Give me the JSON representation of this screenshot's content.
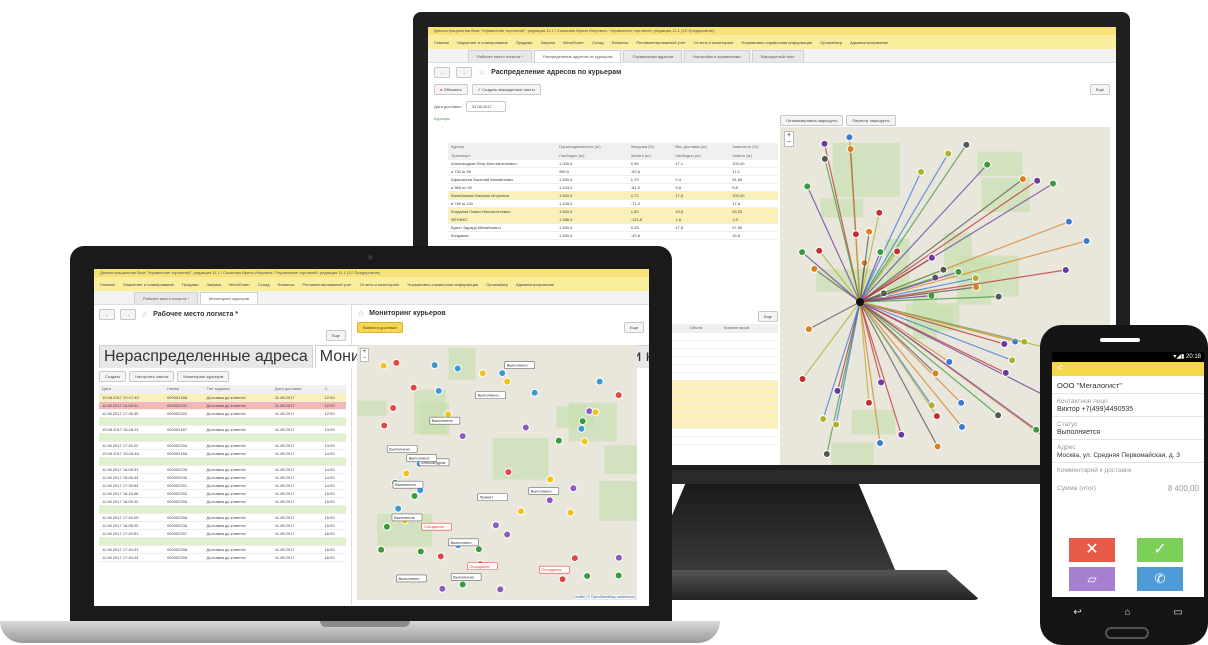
{
  "monitor": {
    "window_title": "Демонстрационная база \"Управление торговлей\", редакция 11.1 / Сазонова Ирина Игоревна / Управление торговлей, редакция 11.1 (1С:Предприятие)",
    "menu": [
      "Главное",
      "Маркетинг и планирование",
      "Продажи",
      "Закупки",
      "МетаПоинт",
      "Склад",
      "Финансы",
      "Регламентированный учет",
      "Отчеты и мониторинг",
      "Нормативно-справочная информация",
      "Органайзер",
      "Администрирование"
    ],
    "tabs": [
      "Рабочее место логиста *",
      "Распределение адресов по курьерам",
      "Справочники адресов",
      "Настройки и справочники",
      "Маршрутный лист"
    ],
    "form_title": "Распределение адресов по курьерам",
    "btn_refresh": "Обновить",
    "btn_create_routes": "Создать маршрутные листы",
    "btn_more": "Еще",
    "date_label": "Дата доставки:",
    "date_value": "31.08.2017",
    "couriers_label": "Курьеры",
    "btn_optimize": "Оптимизировать маршруты",
    "btn_rebuild": "Перестр. маршруты",
    "courier_headers": [
      "Курьер",
      "Грузоподъемность (кг)",
      "Загрузка (%)",
      "Вес доставок (кг)",
      "Занятость (%)"
    ],
    "courier_subheaders": [
      "Транспорт",
      "Свободно (кг)",
      "Занято (кг)",
      "Свободно (кг)",
      "Занято (кг)"
    ],
    "couriers": [
      {
        "c": [
          "Александров Петр Константинович",
          "1 000,0",
          "0,96",
          "17,1",
          "100,00"
        ],
        "hl": false
      },
      {
        "c": [
          "а 734 ш 99",
          "950,0",
          "-50,6",
          "",
          "17,1"
        ],
        "hl": false
      },
      {
        "c": [
          "Афанасьев Василий Михайлович",
          "1 500,0",
          "1,79",
          "9,3",
          "91,85"
        ],
        "hl": false
      },
      {
        "c": [
          "а 360 ес 50",
          "1 443,0",
          "-61,0",
          "9,8",
          "9,8"
        ],
        "hl": false
      },
      {
        "c": [
          "Балабанова Наталья Игоревна",
          "1 500,0",
          "0,72",
          "17,8",
          "100,00"
        ],
        "hl": true
      },
      {
        "c": [
          "в 789 ш 100",
          "1 428,0",
          "-71,0",
          "",
          "17,8"
        ],
        "hl": false
      },
      {
        "c": [
          "Богданов Павел Иннокентьевич",
          "1 500,0",
          "1,83",
          "10,8",
          "83,33"
        ],
        "hl": true
      },
      {
        "c": [
          "ФЕНИКС",
          "1 386,0",
          "-113,8",
          "1,8",
          "1,8"
        ],
        "hl": true
      },
      {
        "c": [
          "Букин Эдуард Михайлович",
          "1 500,0",
          "0,28",
          "17,8",
          "97,56"
        ],
        "hl": false
      },
      {
        "c": [
          "Кондаков",
          "1 500,0",
          "-40,8",
          "",
          "15,8"
        ],
        "hl": false
      }
    ],
    "lower_more": "Еще",
    "lower_headers": [
      "%",
      "Вес",
      "Объем",
      "Комментарий"
    ],
    "lower_rows": [
      {
        "c": [
          "16:00",
          "1,0"
        ],
        "hl": false
      },
      {
        "c": [
          "13:00",
          ""
        ],
        "hl": false
      },
      {
        "c": [
          "14:00",
          "16,2"
        ],
        "hl": false
      },
      {
        "c": [
          "17:00",
          "5,0"
        ],
        "hl": false
      },
      {
        "c": [
          "12:00",
          "130,0"
        ],
        "hl": false
      },
      {
        "c": [
          "08:00",
          "10,5"
        ],
        "hl": false
      },
      {
        "c": [
          "16:00",
          "10,5"
        ],
        "hl": true
      },
      {
        "c": [
          "19:00",
          "10,6"
        ],
        "hl": true
      },
      {
        "c": [
          "16:00",
          "10,0"
        ],
        "hl": true
      },
      {
        "c": [
          "19:00",
          "1,0"
        ],
        "hl": true
      },
      {
        "c": [
          "16:00",
          "5,0"
        ],
        "hl": true
      },
      {
        "c": [
          "19:00",
          "0,5"
        ],
        "hl": true
      },
      {
        "c": [
          "18:00",
          "5,0"
        ],
        "hl": false
      },
      {
        "c": [
          "19:00",
          "0,0"
        ],
        "hl": false
      }
    ]
  },
  "laptop": {
    "window_title": "Демонстрационная база \"Управление торговлей\", редакция 11.1 / Сазонова Ирина Игоревна / Управление торговлей, редакция 11.1 (1С:Предприятие)",
    "menu": [
      "Главное",
      "Маркетинг и планирование",
      "Продажи",
      "Закупки",
      "МетаПоинт",
      "Склад",
      "Финансы",
      "Регламентированный учет",
      "Отчеты и мониторинг",
      "Нормативно-справочная информация",
      "Органайзер",
      "Администрирование"
    ],
    "tabs": [
      "Рабочее место логиста *",
      "Мониторинг курьеров"
    ],
    "left_title": "Рабочее место логиста *",
    "right_title": "Мониторинг курьеров",
    "subtabs": [
      "Нераспределенные адреса",
      "Мониторинг доставки",
      "Рейсы",
      "Транспорт и курьеры"
    ],
    "btn_create": "Создать",
    "btn_show_orders": "Настроить список",
    "courier_monitor": "Мониторинг курьеров",
    "btn_more": "Еще",
    "btn_show_deliveries": "Вывести доставки",
    "current_time_label": "Текущее время:",
    "current_time": "11.08.2017 09:57:31",
    "headers": [
      "Дата",
      "Номер",
      "Тип задания",
      "Дата доставки",
      "С"
    ],
    "rows": [
      {
        "c": [
          "10.08.2017 10:17:40",
          "000002166",
          "Доставка до клиента",
          "11.08.2017",
          "12:00"
        ],
        "t": "hl"
      },
      {
        "c": [
          "11.08.2017 14:58:01",
          "000002201",
          "Доставка до клиента",
          "11.08.2017",
          "12:00"
        ],
        "t": "red"
      },
      {
        "c": [
          "11.08.2017 17:36:35",
          "000002202",
          "Доставка до клиента",
          "11.08.2017",
          "12:00"
        ],
        "t": ""
      },
      {
        "c": [
          "",
          "",
          "",
          "",
          ""
        ],
        "t": "green"
      },
      {
        "c": [
          "10.08.2017 16:18:31",
          "000002167",
          "Доставка до клиента",
          "11.08.2017",
          "13:00"
        ],
        "t": ""
      },
      {
        "c": [
          "",
          "",
          "",
          "",
          ""
        ],
        "t": "green"
      },
      {
        "c": [
          "11.08.2017 17:40:22",
          "000002204",
          "Доставка до клиента",
          "11.08.2017",
          "13:00"
        ],
        "t": ""
      },
      {
        "c": [
          "10.08.2017 15:16:48",
          "000002168",
          "Доставка до клиента",
          "11.08.2017",
          "14:00"
        ],
        "t": ""
      },
      {
        "c": [
          "",
          "",
          "",
          "",
          ""
        ],
        "t": "green"
      },
      {
        "c": [
          "11.08.2017 16:08:31",
          "000002239",
          "Доставка до клиента",
          "11.08.2017",
          "14:00"
        ],
        "t": ""
      },
      {
        "c": [
          "11.08.2017 10:06:44",
          "000002240",
          "Доставка до клиента",
          "11.08.2017",
          "14:00"
        ],
        "t": ""
      },
      {
        "c": [
          "11.08.2017 17:39:54",
          "000002251",
          "Доставка до клиента",
          "11.08.2017",
          "14:00"
        ],
        "t": ""
      },
      {
        "c": [
          "11.08.2017 16:15:48",
          "000002252",
          "Доставка до клиента",
          "11.08.2017",
          "15:00"
        ],
        "t": ""
      },
      {
        "c": [
          "11.08.2017 16:09:12",
          "000002253",
          "Доставка до клиента",
          "11.08.2017",
          "15:00"
        ],
        "t": ""
      },
      {
        "c": [
          "",
          "",
          "",
          "",
          ""
        ],
        "t": "green"
      },
      {
        "c": [
          "11.08.2017 17:40:09",
          "000002256",
          "Доставка до клиента",
          "11.08.2017",
          "15:00"
        ],
        "t": ""
      },
      {
        "c": [
          "11.08.2017 16:06:20",
          "000002236",
          "Доставка до клиента",
          "11.08.2017",
          "15:00"
        ],
        "t": ""
      },
      {
        "c": [
          "11.08.2017 17:40:51",
          "000002257",
          "Доставка до клиента",
          "11.08.2017",
          "16:00"
        ],
        "t": ""
      },
      {
        "c": [
          "",
          "",
          "",
          "",
          ""
        ],
        "t": "green"
      },
      {
        "c": [
          "11.08.2017 17:40:31",
          "000002258",
          "Доставка до клиента",
          "11.08.2017",
          "16:00"
        ],
        "t": ""
      },
      {
        "c": [
          "11.08.2017 17:40:44",
          "000002259",
          "Доставка до клиента",
          "11.08.2017",
          "16:00"
        ],
        "t": ""
      }
    ],
    "map_tags": [
      "Выполнено",
      "Выполнено",
      "Выполнено",
      "Выполнено",
      "Александров",
      "Опоздание",
      "Выполнено",
      "Выполнено",
      "Опоздание",
      "Выполнено",
      "Выполнено",
      "Выполнено",
      "Опоздание",
      "Выполнено",
      "Принят",
      "Выполнено"
    ],
    "map_credit": "Leaflet | © OpenStreetMap contributors"
  },
  "phone": {
    "status_time": "20:18",
    "back": "<",
    "company": "ООО \"Мегалогист\"",
    "contact_label": "Контактное лицо",
    "contact_value": "Виктор +7(499)4490535",
    "status_label": "Статус",
    "status_value": "Выполняется",
    "address_label": "Адрес",
    "address_value": "Москва, ул. Средняя Первомайская, д. 3",
    "comment_label": "Комментарий к доставке",
    "sum_label": "Сумма (итог)",
    "sum_value": "8 400,00",
    "colors": {
      "red": "#e85a48",
      "green": "#7ccf58",
      "purple": "#a77fd1",
      "blue": "#4f9ad9",
      "yellow": "#f6d64a"
    }
  }
}
